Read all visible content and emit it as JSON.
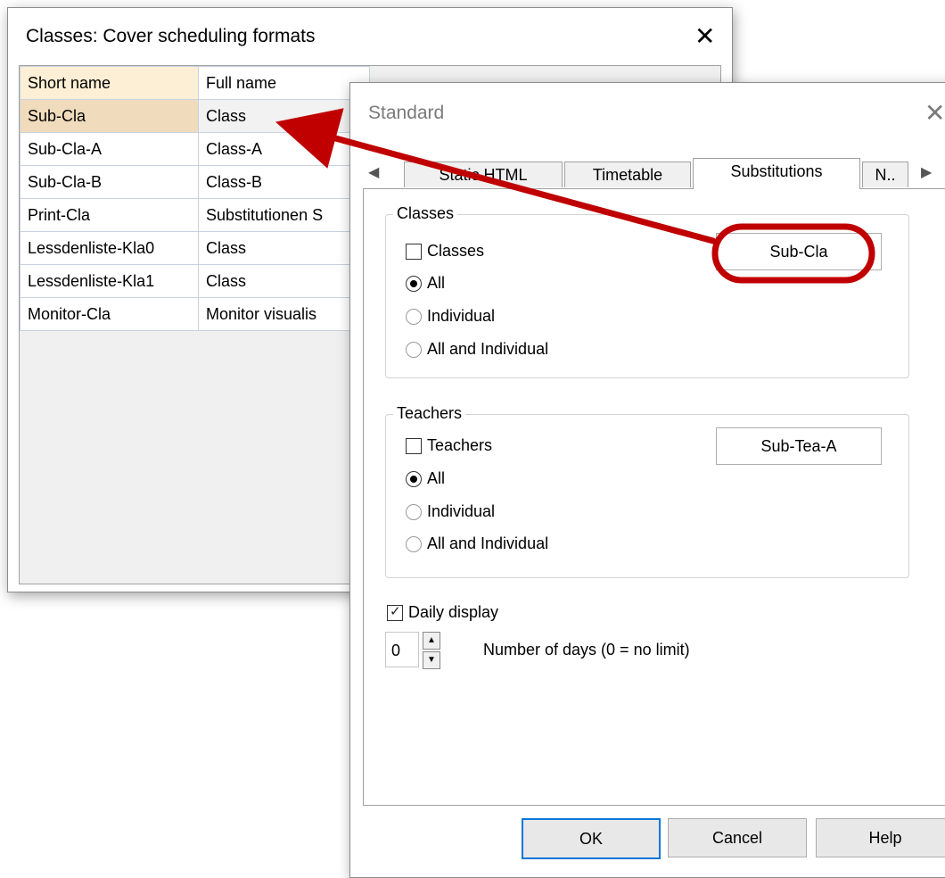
{
  "back_window": {
    "title": "Classes: Cover scheduling formats",
    "close_glyph": "✕",
    "columns": [
      "Short name",
      "Full name"
    ],
    "rows": [
      [
        "Sub-Cla",
        "Class"
      ],
      [
        "Sub-Cla-A",
        "Class-A"
      ],
      [
        "Sub-Cla-B",
        "Class-B"
      ],
      [
        "Print-Cla",
        "Substitutionen S"
      ],
      [
        "Lessdenliste-Kla0",
        "Class"
      ],
      [
        "Lessdenliste-Kla1",
        "Class"
      ],
      [
        "Monitor-Cla",
        "Monitor visualis"
      ]
    ],
    "selected_row": 0
  },
  "dialog": {
    "title": "Standard",
    "close_glyph": "✕",
    "tabs": [
      "Static HTML",
      "Timetable",
      "Substitutions",
      "N.."
    ],
    "active_tab": 2,
    "classes_group": {
      "title": "Classes",
      "checkbox_label": "Classes",
      "options": [
        "All",
        "Individual",
        "All and Individual"
      ],
      "selected": 0,
      "format_button": "Sub-Cla"
    },
    "teachers_group": {
      "title": "Teachers",
      "checkbox_label": "Teachers",
      "options": [
        "All",
        "Individual",
        "All and Individual"
      ],
      "selected": 0,
      "format_button": "Sub-Tea-A"
    },
    "daily_display_label": "Daily display",
    "days_value": "0",
    "days_label": "Number of days (0 = no limit)",
    "buttons": {
      "ok": "OK",
      "cancel": "Cancel",
      "help": "Help"
    }
  },
  "annotation_color": "#c00000"
}
